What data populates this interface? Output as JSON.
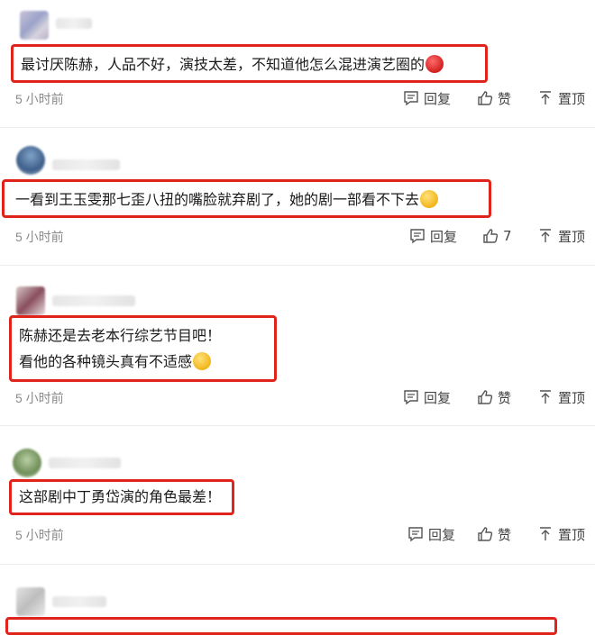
{
  "actions": {
    "reply": "回复",
    "like": "赞",
    "pin": "置顶"
  },
  "comments": [
    {
      "lines": [
        "最讨厌陈赫，人品不好，演技太差，不知道他怎么混进演艺圈的"
      ],
      "emoji": "angry",
      "time": "5 小时前",
      "like_label": "赞"
    },
    {
      "lines": [
        "一看到王玉雯那七歪八扭的嘴脸就弃剧了，她的剧一部看不下去"
      ],
      "emoji": "laugh",
      "time": "5 小时前",
      "like_label": "7"
    },
    {
      "lines": [
        "陈赫还是去老本行综艺节目吧！",
        "看他的各种镜头真有不适感"
      ],
      "emoji": "laugh",
      "time": "5 小时前",
      "like_label": "赞"
    },
    {
      "lines": [
        "这部剧中丁勇岱演的角色最差！"
      ],
      "emoji": "",
      "time": "5 小时前",
      "like_label": "赞"
    }
  ]
}
